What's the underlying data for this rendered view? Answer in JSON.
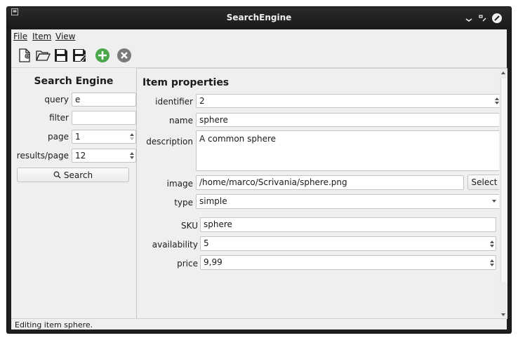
{
  "window": {
    "title": "SearchEngine"
  },
  "menu": {
    "file": "File",
    "item": "Item",
    "view": "View"
  },
  "toolbar": [
    "new-document-icon",
    "open-folder-icon",
    "save-icon",
    "save-as-icon",
    "add-icon",
    "remove-icon"
  ],
  "search": {
    "title": "Search Engine",
    "query_label": "query",
    "query_value": "e",
    "filter_label": "filter",
    "filter_value": "",
    "page_label": "page",
    "page_value": "1",
    "results_label": "results/page",
    "results_value": "12",
    "button_label": "Search"
  },
  "item": {
    "title": "Item properties",
    "identifier_label": "identifier",
    "identifier_value": "2",
    "name_label": "name",
    "name_value": "sphere",
    "description_label": "description",
    "description_value": "A common sphere",
    "image_label": "image",
    "image_value": "/home/marco/Scrivania/sphere.png",
    "select_label": "Select",
    "type_label": "type",
    "type_value": "simple",
    "sku_label": "SKU",
    "sku_value": "sphere",
    "availability_label": "availability",
    "availability_value": "5",
    "price_label": "price",
    "price_value": "9,99"
  },
  "status": "Editing item sphere.",
  "colors": {
    "add": "#4aa84a",
    "remove": "#7a7a7a",
    "titlebar": "#1e1e1e"
  }
}
